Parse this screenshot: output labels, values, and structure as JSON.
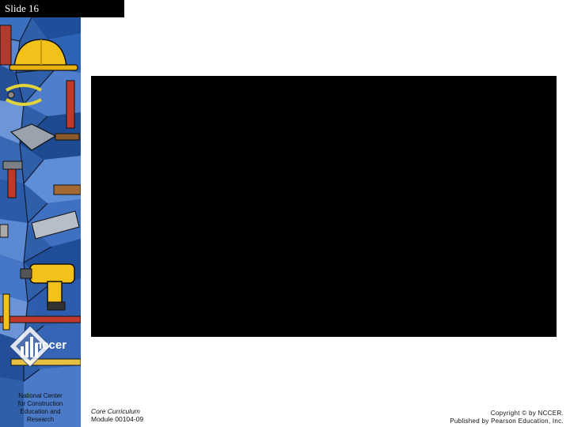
{
  "slide": {
    "label": "Slide 16"
  },
  "organization": {
    "logo_text": "nccer",
    "caption_lines": [
      "National Center",
      "for Construction",
      "Education and",
      "Research"
    ]
  },
  "footer": {
    "course_line": "Core Curriculum",
    "module_line": "Module 00104-09",
    "copyright_line": "Copyright © by NCCER.",
    "publisher_line": "Published by Pearson Education, Inc."
  },
  "colors": {
    "header_bg": "#000000",
    "video_bg": "#000000",
    "sidebar_blue": "#2f5fa8",
    "accent_yellow": "#f2c21b",
    "accent_red": "#c0392b"
  },
  "icons": [
    "hard-hat-icon",
    "pliers-icon",
    "trowel-icon",
    "hammer-icon",
    "power-drill-icon",
    "level-icon",
    "nccer-logo-icon"
  ]
}
